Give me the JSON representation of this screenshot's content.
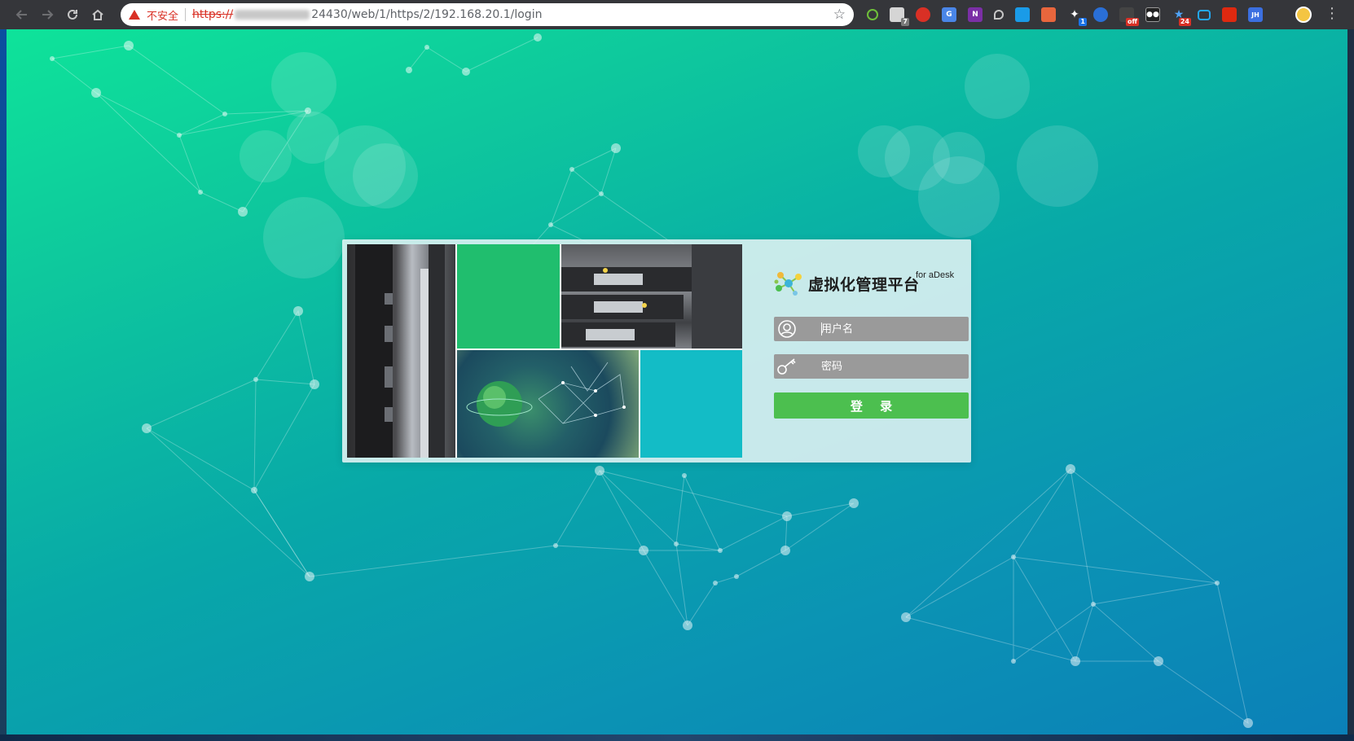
{
  "browser": {
    "url_warning": "不安全",
    "url_scheme": "https://",
    "url_rest": "24430/web/1/https/2/192.168.20.1/login",
    "extension_badges": {
      "mail": "7",
      "twitter": "1",
      "off": "off",
      "star": "24"
    }
  },
  "login": {
    "brand_title": "虚拟化管理平台",
    "brand_subtitle": "for aDesk",
    "username_placeholder": "用户名",
    "password_placeholder": "密码",
    "submit_label": "登 录"
  },
  "colors": {
    "login_button": "#4cbf4f",
    "input_bg": "#9a9a9a",
    "tile_green": "#20be6e",
    "tile_teal": "#13bcc6"
  }
}
